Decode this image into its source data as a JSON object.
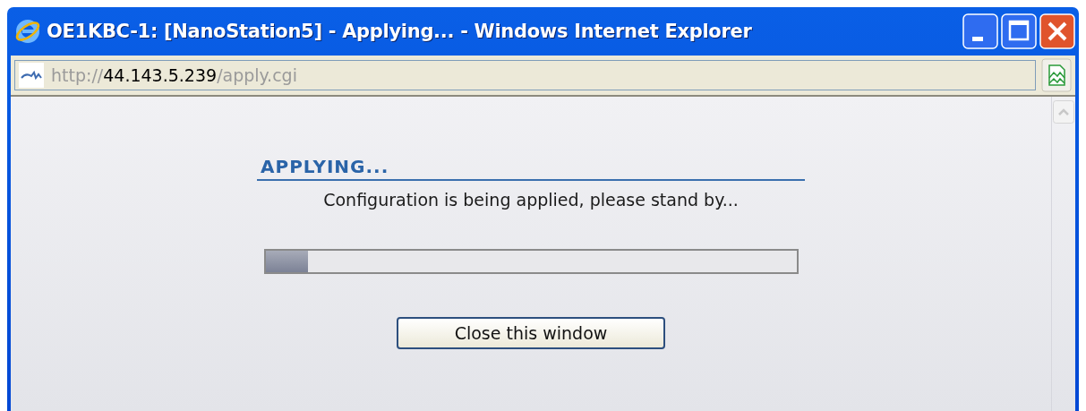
{
  "window": {
    "title": "OE1KBC-1: [NanoStation5] - Applying... - Windows Internet Explorer"
  },
  "address_bar": {
    "scheme": "http://",
    "host": "44.143.5.239",
    "path": "/apply.cgi"
  },
  "page": {
    "heading": "APPLYING...",
    "message": "Configuration is being applied, please stand by...",
    "progress": {
      "level": 0.08
    },
    "button": "Close this window"
  }
}
